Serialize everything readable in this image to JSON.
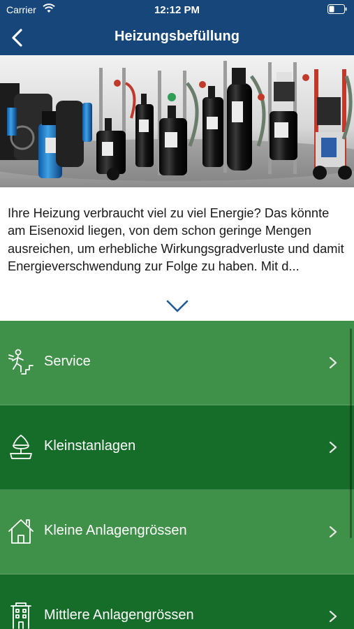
{
  "status_bar": {
    "carrier": "Carrier",
    "time": "12:12 PM"
  },
  "nav": {
    "title": "Heizungsbefüllung",
    "back_icon": "chevron-left-icon"
  },
  "hero": {
    "image": "product-photo-filling-devices"
  },
  "intro": {
    "text": "Ihre Heizung verbraucht viel zu viel Energie? Das könnte am Eisenoxid liegen, von dem schon geringe Mengen ausreichen, um erhebliche Wirkungsgradverluste und damit Energieverschwendung zur Folge zu haben. Mit d...",
    "expand_icon": "chevron-down-icon"
  },
  "menu": {
    "items": [
      {
        "label": "Service",
        "icon": "person-stairs-icon",
        "tone": "light"
      },
      {
        "label": "Kleinstanlagen",
        "icon": "fountain-icon",
        "tone": "dark"
      },
      {
        "label": "Kleine Anlagengrössen",
        "icon": "house-icon",
        "tone": "light"
      },
      {
        "label": "Mittlere Anlagengrössen",
        "icon": "building-icon",
        "tone": "dark"
      }
    ]
  },
  "colors": {
    "header": "#16467a",
    "menu_light": "#3f9149",
    "menu_dark": "#166d29"
  }
}
